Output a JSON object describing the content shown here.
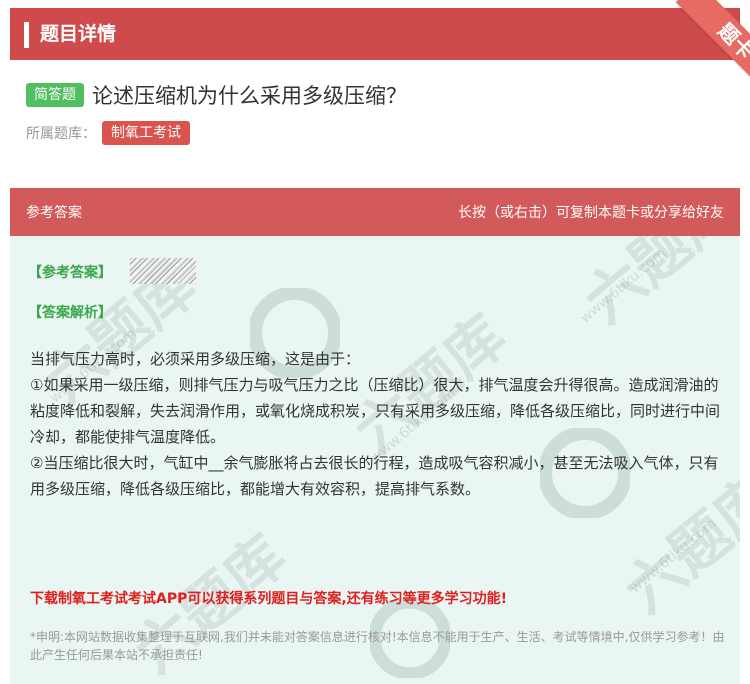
{
  "header": {
    "title": "题目详情",
    "corner_label": "题卡"
  },
  "question": {
    "type_badge": "简答题",
    "text": "论述压缩机为什么采用多级压缩？",
    "bank_label": "所属题库：",
    "bank_name": "制氧工考试"
  },
  "answer_panel": {
    "header_left": "参考答案",
    "header_right": "长按（或右击）可复制本题卡或分享给好友",
    "answer_tag": "【参考答案】",
    "analysis_tag": "【答案解析】",
    "paragraphs": [
      "当排气压力高时，必须采用多级压缩，这是由于：",
      "①如果采用一级压缩，则排气压力与吸气压力之比（压缩比）很大，排气温度会升得很高。造成润滑油的粘度降低和裂解，失去润滑作用，或氧化烧成积炭，只有采用多级压缩，降低各级压缩比，同时进行中间冷却，都能使排气温度降低。",
      "②当压缩比很大时，气缸中__余气膨胀将占去很长的行程，造成吸气容积减小，甚至无法吸入气体，只有用多级压缩，降低各级压缩比，都能增大有效容积，提高排气系数。"
    ],
    "promo": "下载制氧工考试考试APP可以获得系列题目与答案,还有练习等更多学习功能!",
    "disclaimer": "*申明:本网站数据收集整理于互联网,我们并未能对答案信息进行核对!本信息不能用于生产、生活、考试等情境中,仅供学习参考！由此产生任何后果本站不承担责任!"
  },
  "watermark": {
    "text": "六题库",
    "url": "www.6tiku.com"
  },
  "colors": {
    "header_red": "#cf4b4b",
    "panel_bg": "#eaf6f3",
    "badge_green": "#4fbf5f",
    "tag_red": "#d9534f",
    "promo_red": "#e0201e"
  }
}
